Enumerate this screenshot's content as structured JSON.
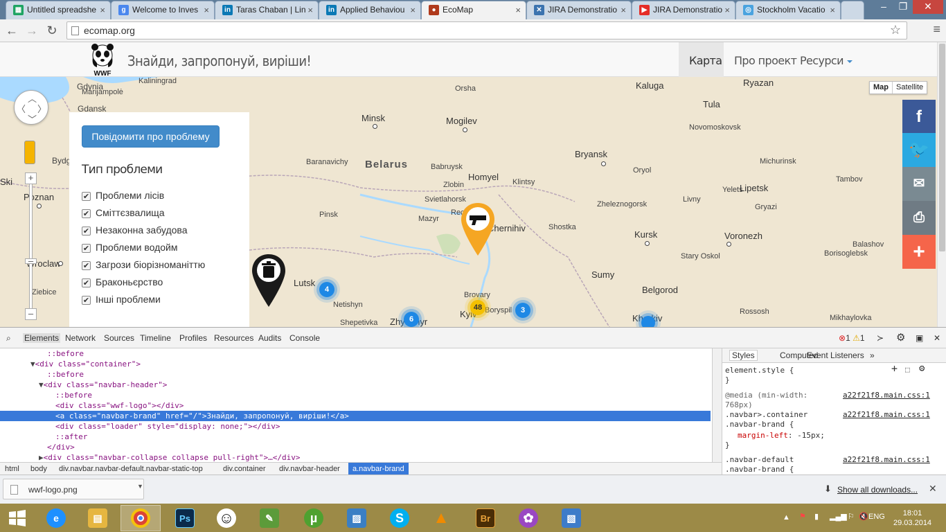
{
  "browser": {
    "tabs": [
      {
        "title": "Untitled spreadshe",
        "icon": "sheets-icon",
        "color": "#1fa463"
      },
      {
        "title": "Welcome to Inves",
        "icon": "google-icon",
        "color": "#4a87ee"
      },
      {
        "title": "Taras Chaban | Lin",
        "icon": "linkedin-icon",
        "color": "#0b79b5"
      },
      {
        "title": "Applied Behaviou",
        "icon": "linkedin-icon",
        "color": "#0b79b5"
      },
      {
        "title": "EcoMap",
        "icon": "ecomap-icon",
        "color": "#b03a1c"
      },
      {
        "title": "JIRA Demonstratio",
        "icon": "jira-icon",
        "color": "#3b73af"
      },
      {
        "title": "JIRA Demonstratio",
        "icon": "youtube-icon",
        "color": "#e52d27"
      },
      {
        "title": "Stockholm Vacatio",
        "icon": "tripadvisor-icon",
        "color": "#4aa3df"
      }
    ],
    "url": "ecomap.org"
  },
  "site": {
    "brand": "Знайди, запропонуй, виріши!",
    "logo_text": "WWF",
    "nav": [
      "Карта",
      "Про проект",
      "Ресурси"
    ],
    "report_button": "Повідомити про проблему",
    "filter_title": "Тип проблеми",
    "filters": [
      "Проблеми лісів",
      "Сміттєзвалища",
      "Незаконна забудова",
      "Проблеми водойм",
      "Загрози біорізноманіттю",
      "Браконьєрство",
      "Інші проблеми"
    ],
    "map_type": {
      "map": "Map",
      "satellite": "Satellite"
    },
    "share": [
      {
        "icon": "facebook-icon",
        "glyph": "f",
        "color": "#3b5998"
      },
      {
        "icon": "twitter-icon",
        "glyph": "t",
        "color": "#2ba9e1"
      },
      {
        "icon": "email-icon",
        "glyph": "✉",
        "color": "#7a8a92"
      },
      {
        "icon": "print-icon",
        "glyph": "⎙",
        "color": "#6f7b84"
      },
      {
        "icon": "plus-icon",
        "glyph": "+",
        "color": "#f5654a"
      }
    ],
    "clusters": [
      "4",
      "6",
      "48",
      "3"
    ],
    "places": {
      "big": [
        "Belarus"
      ],
      "cities": [
        "Minsk",
        "Mogilev",
        "Bryansk",
        "Kursk",
        "Voronezh",
        "Kaluga",
        "Tula",
        "Ryazan",
        "Lipetsk",
        "Belgorod",
        "Homyel",
        "Chernihiv",
        "Lutsk",
        "Sumy",
        "Poznan",
        "Wroclaw",
        "Gdynia",
        "Gdansk",
        "Bryansk"
      ],
      "towns": [
        "Orsha",
        "Babruysk",
        "Baranavichy",
        "Pinsk",
        "Mazyr",
        "Zlobin",
        "Svietlahorsk",
        "Klintsy",
        "Shostka",
        "Oryol",
        "Novomoskovsk",
        "Yelets",
        "Gryazi",
        "Zheleznogorsk",
        "Livny",
        "Stary Oskol",
        "Balashov",
        "Borisoglebsk",
        "Michurinsk",
        "Tambov",
        "Rossosh",
        "Mikhaylovka",
        "Marijampolė",
        "Kaliningrad",
        "Bydg",
        "Ziebice",
        "Netishyn",
        "Shepetivka",
        "Zhytomyr",
        "Brovary",
        "Boryspil",
        "Kyiv",
        "Kharkiv",
        "Recyca",
        "Ski"
      ]
    }
  },
  "devtools": {
    "tabs": [
      "Elements",
      "Network",
      "Sources",
      "Timeline",
      "Profiles",
      "Resources",
      "Audits",
      "Console"
    ],
    "errors": "1",
    "warnings": "1",
    "dom_lines": [
      "::before",
      "<div class=\"container\">",
      "::before",
      "<div class=\"navbar-header\">",
      "::before",
      "<div class=\"wwf-logo\"></div>",
      "<a class=\"navbar-brand\" href=\"/\">Знайди, запропонуй, виріши!</a>",
      "<div class=\"loader\" style=\"display: none;\"></div>",
      "::after",
      "</div>",
      "<div class=\"navbar-collapse collapse pull-right\">…</div>"
    ],
    "breadcrumbs": [
      "html",
      "body",
      "div.navbar.navbar-default.navbar-static-top",
      "div.container",
      "div.navbar-header",
      "a.navbar-brand"
    ],
    "style_tabs": [
      "Styles",
      "Computed",
      "Event Listeners"
    ],
    "styles": {
      "element_style": "element.style {",
      "close": "}",
      "media": "@media (min-width:",
      "media2": "768px)",
      "sel1": ".navbar>.container",
      "sel1b": ".navbar-brand {",
      "prop1": "margin-left",
      "val1": "-15px;",
      "sel2": ".navbar-default",
      "sel2b": ".navbar-brand {",
      "source": "a22f21f8.main.css:1"
    }
  },
  "downloads": {
    "file": "wwf-logo.png",
    "show_all": "Show all downloads..."
  },
  "taskbar": {
    "apps": [
      {
        "icon": "ie-icon",
        "glyph": "e",
        "color": "#1e90ff"
      },
      {
        "icon": "explorer-icon",
        "glyph": "▤",
        "color": "#e6b640"
      },
      {
        "icon": "chrome-icon",
        "glyph": "●",
        "color": "#db4437"
      },
      {
        "icon": "photoshop-icon",
        "glyph": "Ps",
        "color": "#0b2a4a"
      },
      {
        "icon": "smiley-icon",
        "glyph": "☺",
        "color": "#ffffff"
      },
      {
        "icon": "notepad-icon",
        "glyph": "✎",
        "color": "#5c9b3a"
      },
      {
        "icon": "utorrent-icon",
        "glyph": "µ",
        "color": "#4fa130"
      },
      {
        "icon": "photos-icon",
        "glyph": "▨",
        "color": "#3a7fc4"
      },
      {
        "icon": "skype-icon",
        "glyph": "S",
        "color": "#00aff0"
      },
      {
        "icon": "vlc-icon",
        "glyph": "▲",
        "color": "#f08a00"
      },
      {
        "icon": "bridge-icon",
        "glyph": "Br",
        "color": "#4a2d06"
      },
      {
        "icon": "picasa-icon",
        "glyph": "✿",
        "color": "#9a47c2"
      },
      {
        "icon": "image-viewer-icon",
        "glyph": "▧",
        "color": "#3d7cc9"
      }
    ],
    "lang": "ENG",
    "time": "18:01",
    "date": "29.03.2014"
  }
}
